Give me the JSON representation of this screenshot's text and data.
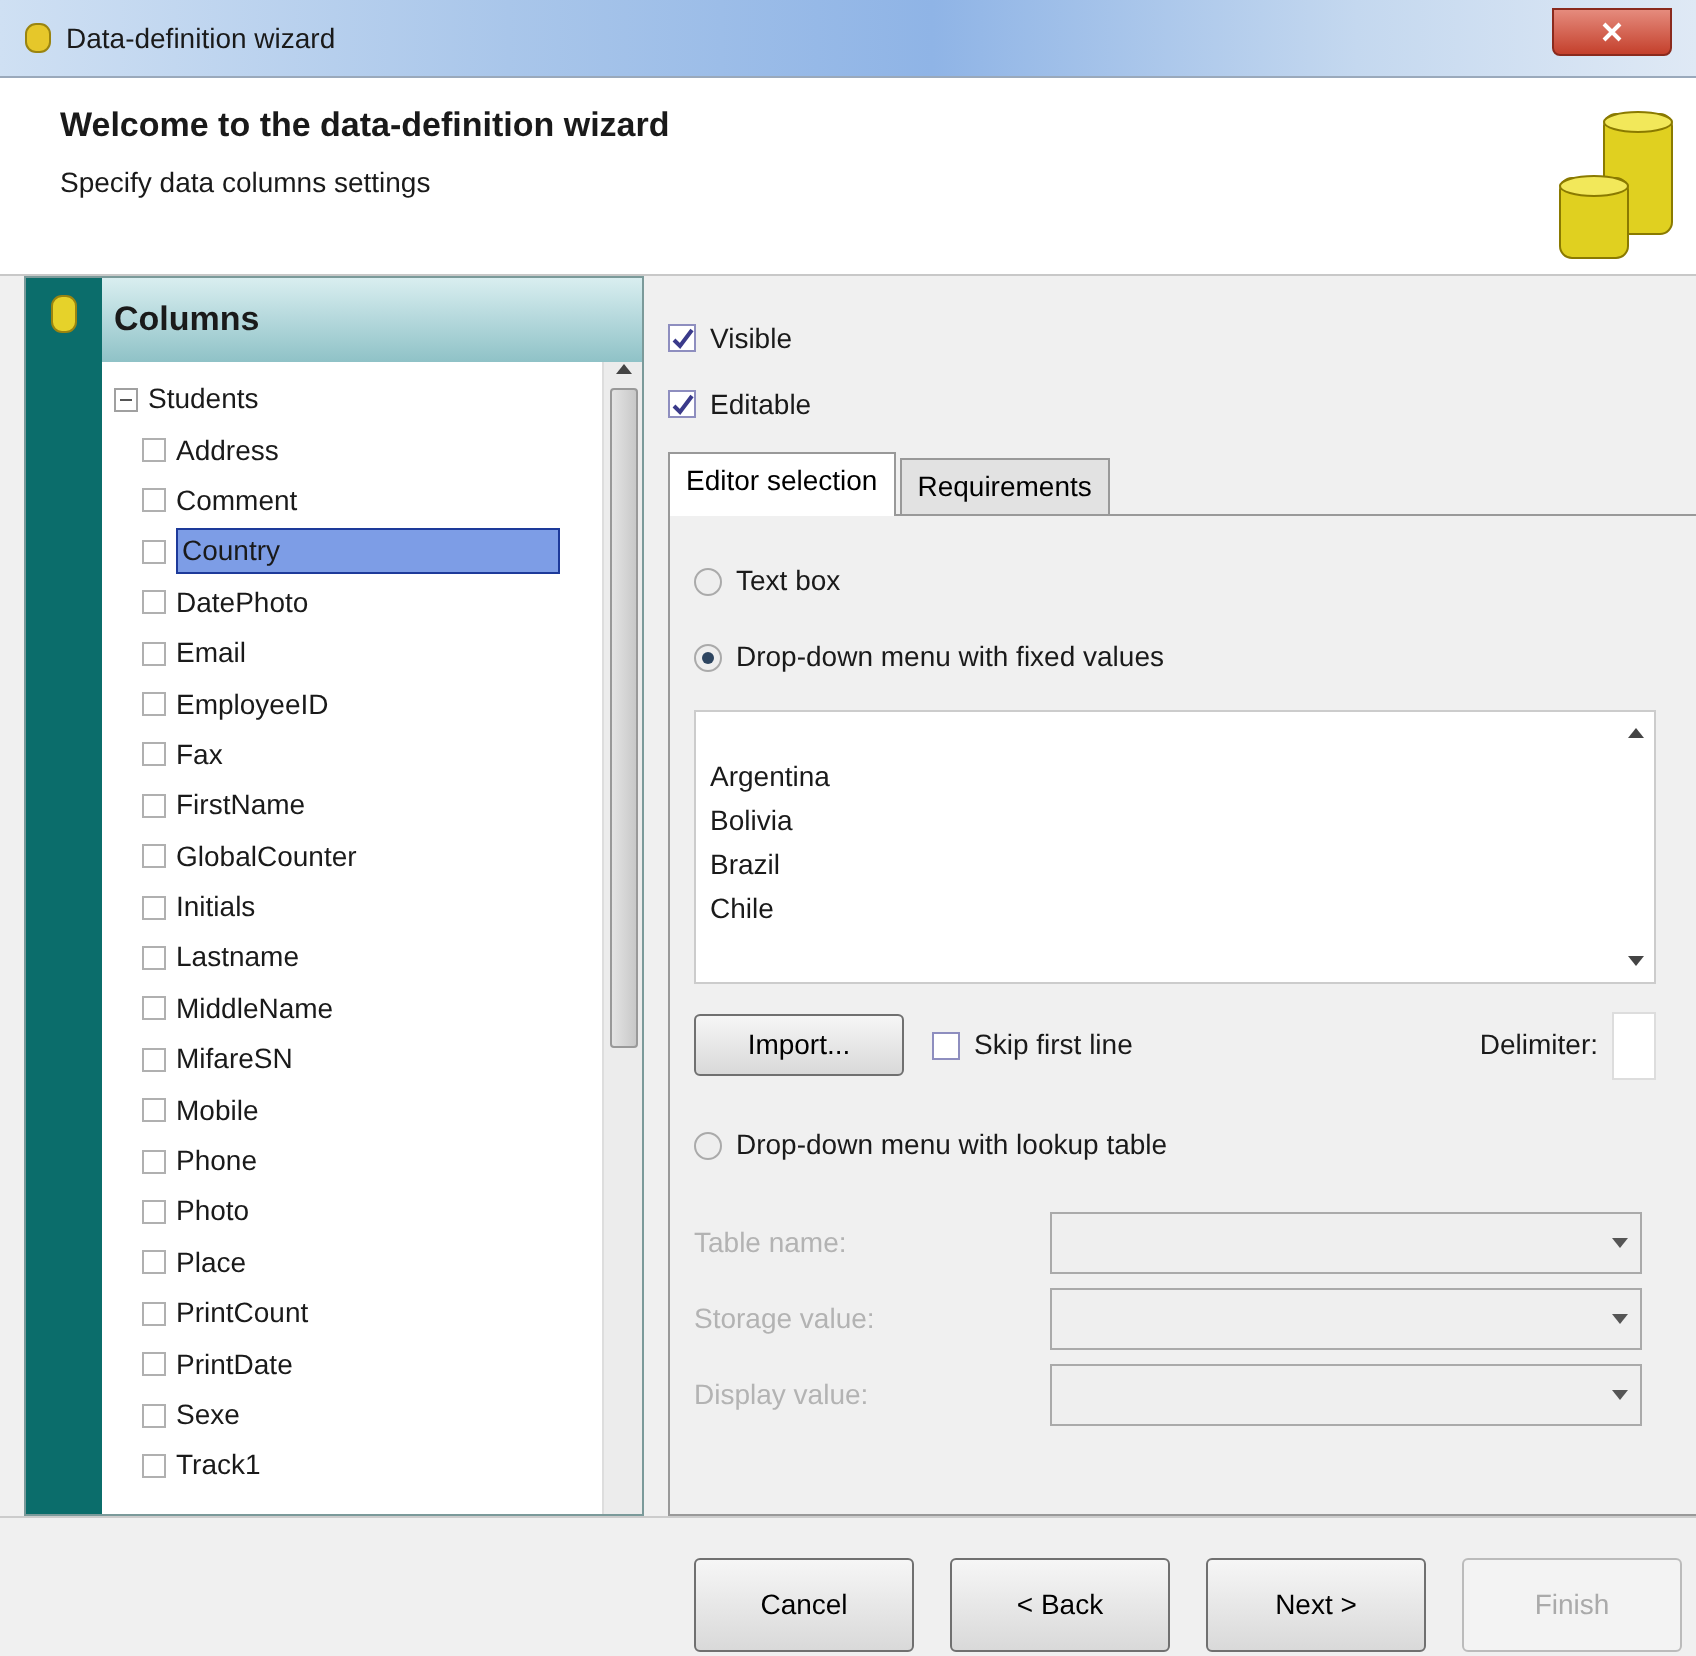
{
  "window": {
    "title": "Data-definition wizard"
  },
  "header": {
    "title": "Welcome to the data-definition wizard",
    "subtitle": "Specify data columns settings"
  },
  "columns_panel": {
    "title": "Columns",
    "tree": [
      {
        "label": "Students",
        "expanded": true,
        "children": [
          {
            "label": "Address",
            "selected": false
          },
          {
            "label": "Comment",
            "selected": false
          },
          {
            "label": "Country",
            "selected": true
          },
          {
            "label": "DatePhoto",
            "selected": false
          },
          {
            "label": "Email",
            "selected": false
          },
          {
            "label": "EmployeeID",
            "selected": false
          },
          {
            "label": "Fax",
            "selected": false
          },
          {
            "label": "FirstName",
            "selected": false
          },
          {
            "label": "GlobalCounter",
            "selected": false
          },
          {
            "label": "Initials",
            "selected": false
          },
          {
            "label": "Lastname",
            "selected": false
          },
          {
            "label": "MiddleName",
            "selected": false
          },
          {
            "label": "MifareSN",
            "selected": false
          },
          {
            "label": "Mobile",
            "selected": false
          },
          {
            "label": "Phone",
            "selected": false
          },
          {
            "label": "Photo",
            "selected": false
          },
          {
            "label": "Place",
            "selected": false
          },
          {
            "label": "PrintCount",
            "selected": false
          },
          {
            "label": "PrintDate",
            "selected": false
          },
          {
            "label": "Sexe",
            "selected": false
          },
          {
            "label": "Track1",
            "selected": false
          }
        ]
      }
    ]
  },
  "options": [
    {
      "label": "Visible",
      "checked": true
    },
    {
      "label": "Editable",
      "checked": true
    }
  ],
  "tabs": [
    {
      "label": "Editor selection",
      "selected": true
    },
    {
      "label": "Requirements",
      "selected": false
    }
  ],
  "editor_choices": [
    {
      "label": "Text box",
      "selected": false
    },
    {
      "label": "Drop-down menu with fixed values",
      "selected": true
    },
    {
      "label": "Drop-down menu with lookup table",
      "selected": false
    }
  ],
  "fixed_values": [
    "Argentina",
    "Bolivia",
    "Brazil",
    "Chile"
  ],
  "import_button": "Import...",
  "skip_first_line": {
    "label": "Skip first line",
    "checked": false
  },
  "delimiter": {
    "label": "Delimiter:"
  },
  "lookup_fields": [
    {
      "label": "Table name:",
      "disabled": true
    },
    {
      "label": "Storage value:",
      "disabled": true
    },
    {
      "label": "Display value:",
      "disabled": true
    }
  ],
  "buttons": [
    {
      "label": "Cancel",
      "disabled": false
    },
    {
      "label": "< Back",
      "disabled": false
    },
    {
      "label": "Next >",
      "disabled": false
    },
    {
      "label": "Finish",
      "disabled": true
    }
  ]
}
